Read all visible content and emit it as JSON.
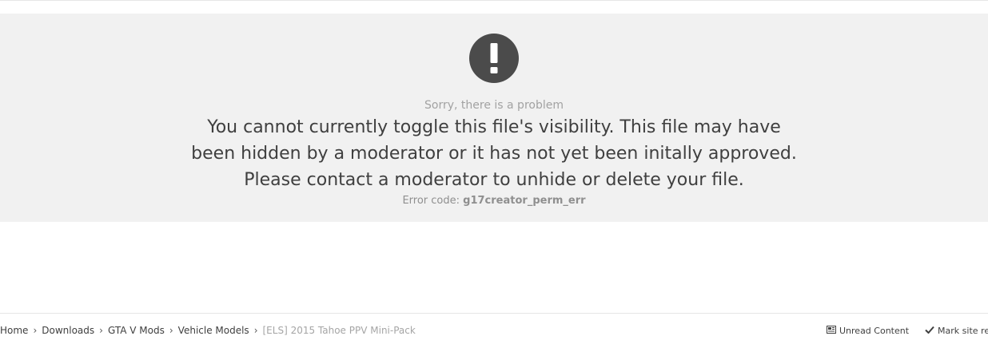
{
  "error": {
    "icon": "exclamation-icon",
    "heading": "Sorry, there is a problem",
    "message": "You cannot currently toggle this file's visibility. This file may have been hidden by a moderator or it has not yet been initally approved. Please contact a moderator to unhide or delete your file.",
    "code_label": "Error code:",
    "code_value": "g17creator_perm_err"
  },
  "breadcrumb": {
    "items": [
      "Home",
      "Downloads",
      "GTA V Mods",
      "Vehicle Models"
    ],
    "current": "[ELS] 2015 Tahoe PPV Mini-Pack",
    "separator_icon": "chevron-right-icon"
  },
  "footer_links": {
    "unread": {
      "label": "Unread Content",
      "icon": "unread-icon"
    },
    "mark_read": {
      "label": "Mark site re",
      "icon": "check-icon"
    }
  },
  "colors": {
    "panel_background": "#f1f1f1",
    "icon_circle": "#4b4b4b",
    "heading_text": "#a2a2a2",
    "message_text": "#3f3f3f"
  }
}
